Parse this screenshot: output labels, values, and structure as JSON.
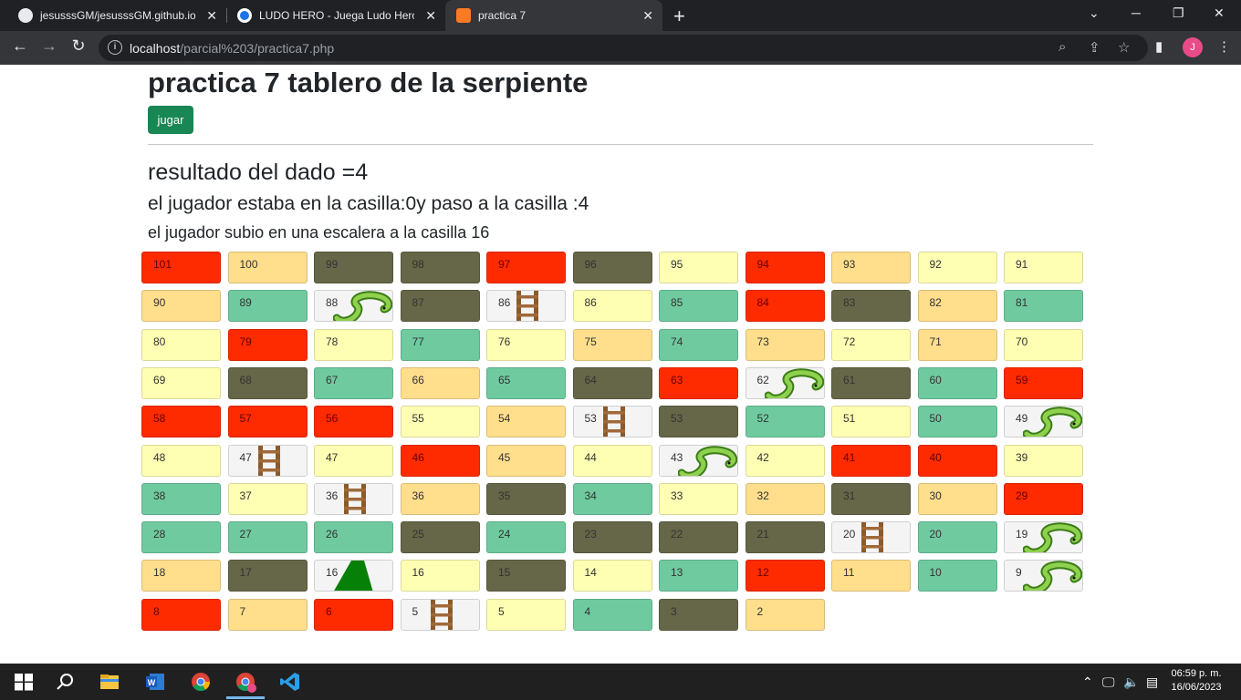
{
  "browser": {
    "tabs": [
      {
        "title": "jesusssGM/jesusssGM.github.io"
      },
      {
        "title": "LUDO HERO - Juega Ludo Hero en"
      },
      {
        "title": "practica 7"
      }
    ],
    "url_host": "localhost",
    "url_path": "/parcial%203/practica7.php",
    "profile_initial": "J"
  },
  "page": {
    "title": "practica 7 tablero de la serpiente",
    "play_button": "jugar",
    "dice_result": "resultado del dado =4",
    "move_text": "el jugador estaba en la casilla:0y paso a la casilla :4",
    "ladder_text": "el jugador subio en una escalera a la casilla 16"
  },
  "board": {
    "rows": [
      [
        {
          "n": "101",
          "c": "red"
        },
        {
          "n": "100",
          "c": "peach"
        },
        {
          "n": "99",
          "c": "olive"
        },
        {
          "n": "98",
          "c": "olive"
        },
        {
          "n": "97",
          "c": "red"
        },
        {
          "n": "96",
          "c": "olive"
        },
        {
          "n": "95",
          "c": "yellow"
        },
        {
          "n": "94",
          "c": "red"
        },
        {
          "n": "93",
          "c": "peach"
        },
        {
          "n": "92",
          "c": "yellow"
        },
        {
          "n": "91",
          "c": "yellow"
        }
      ],
      [
        {
          "n": "90",
          "c": "peach"
        },
        {
          "n": "89",
          "c": "green"
        },
        {
          "n": "88",
          "c": "snake"
        },
        {
          "n": "87",
          "c": "olive"
        },
        {
          "n": "86",
          "c": "ladder"
        },
        {
          "n": "86",
          "c": "yellow"
        },
        {
          "n": "85",
          "c": "green"
        },
        {
          "n": "84",
          "c": "red"
        },
        {
          "n": "83",
          "c": "olive"
        },
        {
          "n": "82",
          "c": "peach"
        },
        {
          "n": "81",
          "c": "green"
        }
      ],
      [
        {
          "n": "80",
          "c": "yellow"
        },
        {
          "n": "79",
          "c": "red"
        },
        {
          "n": "78",
          "c": "yellow"
        },
        {
          "n": "77",
          "c": "green"
        },
        {
          "n": "76",
          "c": "yellow"
        },
        {
          "n": "75",
          "c": "peach"
        },
        {
          "n": "74",
          "c": "green"
        },
        {
          "n": "73",
          "c": "peach"
        },
        {
          "n": "72",
          "c": "yellow"
        },
        {
          "n": "71",
          "c": "peach"
        },
        {
          "n": "70",
          "c": "yellow"
        }
      ],
      [
        {
          "n": "69",
          "c": "yellow"
        },
        {
          "n": "68",
          "c": "olive"
        },
        {
          "n": "67",
          "c": "green"
        },
        {
          "n": "66",
          "c": "peach"
        },
        {
          "n": "65",
          "c": "green"
        },
        {
          "n": "64",
          "c": "olive"
        },
        {
          "n": "63",
          "c": "red"
        },
        {
          "n": "62",
          "c": "snake"
        },
        {
          "n": "61",
          "c": "olive"
        },
        {
          "n": "60",
          "c": "green"
        },
        {
          "n": "59",
          "c": "red"
        }
      ],
      [
        {
          "n": "58",
          "c": "red"
        },
        {
          "n": "57",
          "c": "red"
        },
        {
          "n": "56",
          "c": "red"
        },
        {
          "n": "55",
          "c": "yellow"
        },
        {
          "n": "54",
          "c": "peach"
        },
        {
          "n": "53",
          "c": "ladder"
        },
        {
          "n": "53",
          "c": "olive"
        },
        {
          "n": "52",
          "c": "green"
        },
        {
          "n": "51",
          "c": "yellow"
        },
        {
          "n": "50",
          "c": "green"
        },
        {
          "n": "49",
          "c": "snake"
        }
      ],
      [
        {
          "n": "48",
          "c": "yellow"
        },
        {
          "n": "47",
          "c": "ladder"
        },
        {
          "n": "47",
          "c": "yellow"
        },
        {
          "n": "46",
          "c": "red"
        },
        {
          "n": "45",
          "c": "peach"
        },
        {
          "n": "44",
          "c": "yellow"
        },
        {
          "n": "43",
          "c": "snake"
        },
        {
          "n": "42",
          "c": "yellow"
        },
        {
          "n": "41",
          "c": "red"
        },
        {
          "n": "40",
          "c": "red"
        },
        {
          "n": "39",
          "c": "yellow"
        }
      ],
      [
        {
          "n": "38",
          "c": "green"
        },
        {
          "n": "37",
          "c": "yellow"
        },
        {
          "n": "36",
          "c": "ladder"
        },
        {
          "n": "36",
          "c": "peach"
        },
        {
          "n": "35",
          "c": "olive"
        },
        {
          "n": "34",
          "c": "green"
        },
        {
          "n": "33",
          "c": "yellow"
        },
        {
          "n": "32",
          "c": "peach"
        },
        {
          "n": "31",
          "c": "olive"
        },
        {
          "n": "30",
          "c": "peach"
        },
        {
          "n": "29",
          "c": "red"
        }
      ],
      [
        {
          "n": "28",
          "c": "green"
        },
        {
          "n": "27",
          "c": "green"
        },
        {
          "n": "26",
          "c": "green"
        },
        {
          "n": "25",
          "c": "olive"
        },
        {
          "n": "24",
          "c": "green"
        },
        {
          "n": "23",
          "c": "olive"
        },
        {
          "n": "22",
          "c": "olive"
        },
        {
          "n": "21",
          "c": "olive"
        },
        {
          "n": "20",
          "c": "ladder"
        },
        {
          "n": "20",
          "c": "green"
        },
        {
          "n": "19",
          "c": "snake"
        }
      ],
      [
        {
          "n": "18",
          "c": "peach"
        },
        {
          "n": "17",
          "c": "olive"
        },
        {
          "n": "16",
          "c": "player"
        },
        {
          "n": "16",
          "c": "yellow"
        },
        {
          "n": "15",
          "c": "olive"
        },
        {
          "n": "14",
          "c": "yellow"
        },
        {
          "n": "13",
          "c": "green"
        },
        {
          "n": "12",
          "c": "red"
        },
        {
          "n": "11",
          "c": "peach"
        },
        {
          "n": "10",
          "c": "green"
        },
        {
          "n": "9",
          "c": "snake"
        }
      ],
      [
        {
          "n": "8",
          "c": "red"
        },
        {
          "n": "7",
          "c": "peach"
        },
        {
          "n": "6",
          "c": "red"
        },
        {
          "n": "5",
          "c": "ladder"
        },
        {
          "n": "5",
          "c": "yellow"
        },
        {
          "n": "4",
          "c": "green"
        },
        {
          "n": "3",
          "c": "olive"
        },
        {
          "n": "2",
          "c": "peach"
        }
      ]
    ]
  },
  "taskbar": {
    "time": "06:59 p. m.",
    "date": "16/06/2023"
  }
}
